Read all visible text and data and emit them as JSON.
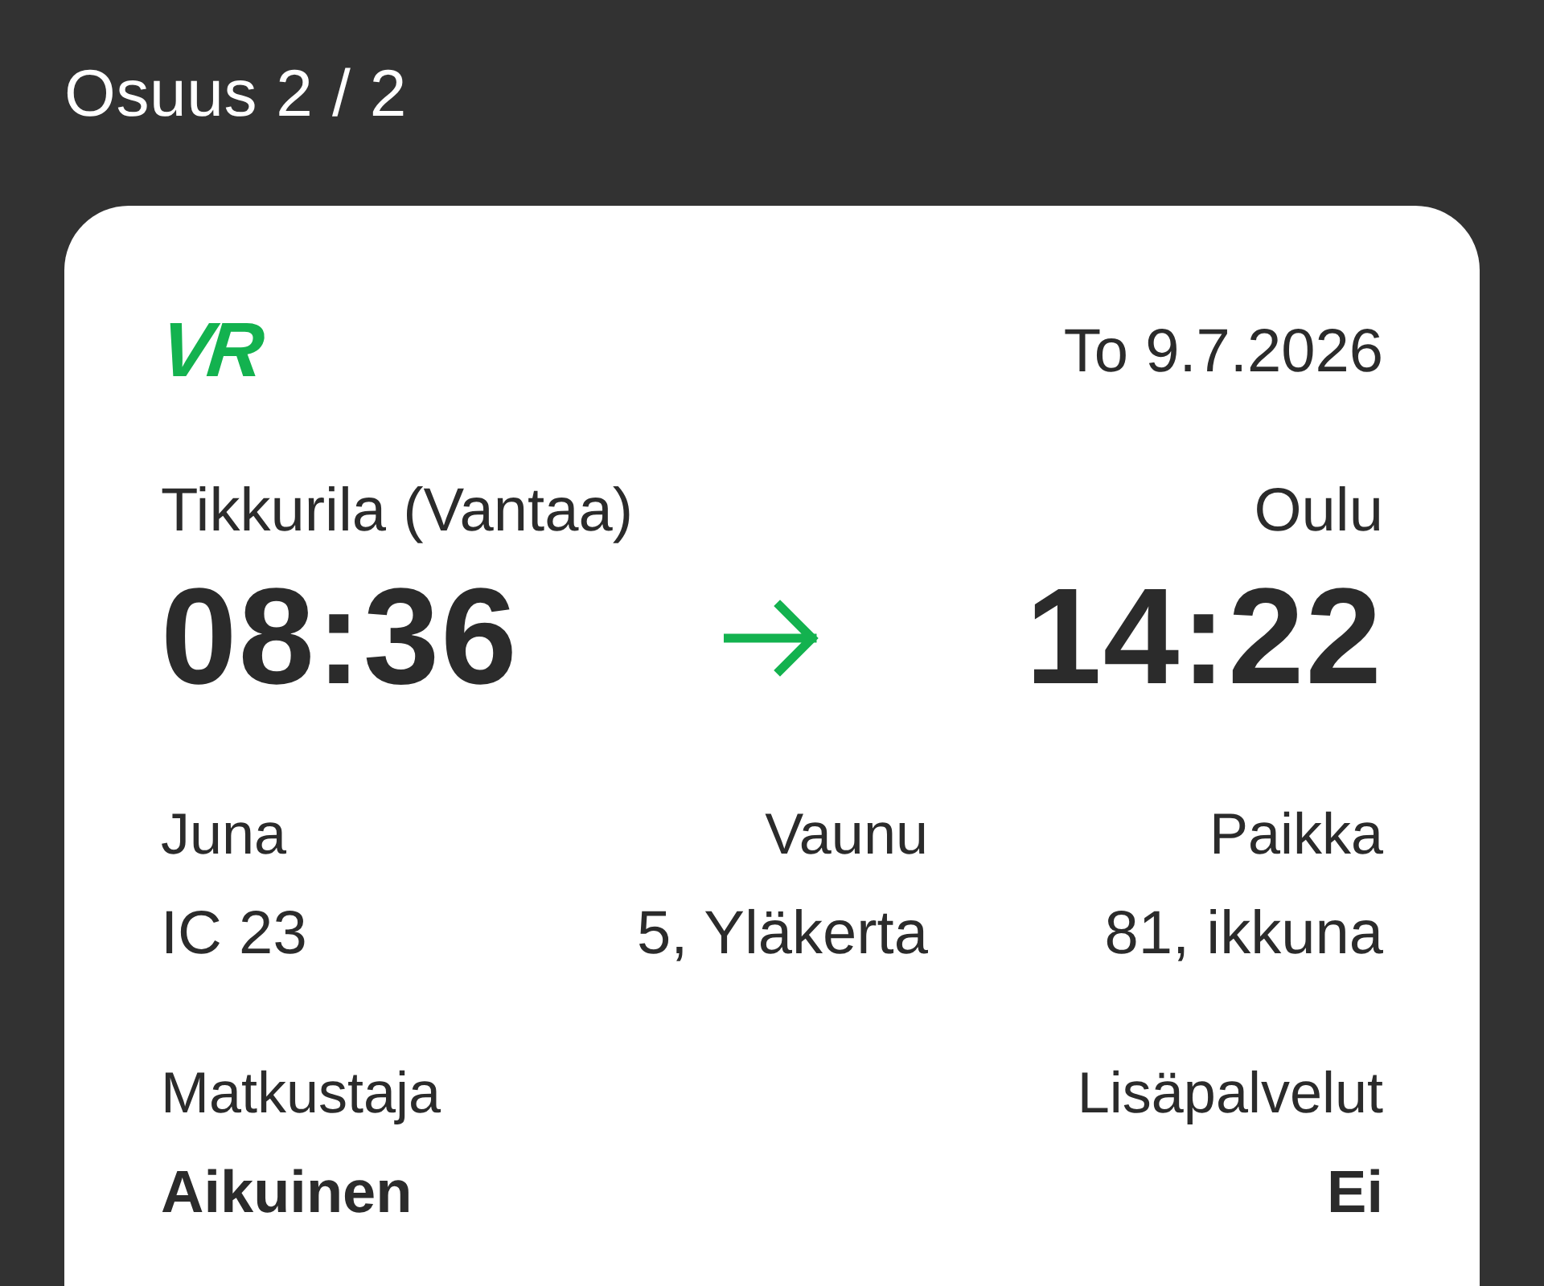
{
  "page": {
    "title": "Osuus 2 / 2"
  },
  "ticket": {
    "logo": "VR",
    "date": "To 9.7.2026",
    "departure": {
      "station": "Tikkurila (Vantaa)",
      "time": "08:36"
    },
    "arrival": {
      "station": "Oulu",
      "time": "14:22"
    },
    "details": [
      {
        "label": "Juna",
        "value": "IC 23"
      },
      {
        "label": "Vaunu",
        "value": "5, Yläkerta"
      },
      {
        "label": "Paikka",
        "value": "81, ikkuna"
      }
    ],
    "extras": [
      {
        "label": "Matkustaja",
        "value": "Aikuinen"
      },
      {
        "label": "Lisäpalvelut",
        "value": "Ei"
      }
    ]
  }
}
